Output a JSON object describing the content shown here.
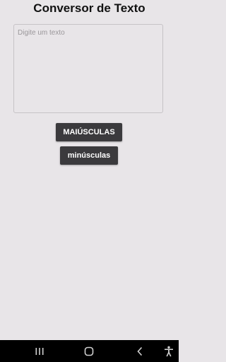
{
  "app": {
    "title": "Conversor de Texto"
  },
  "input": {
    "placeholder": "Digite um texto",
    "value": ""
  },
  "buttons": {
    "uppercase_label": "MAIÚSCULAS",
    "lowercase_label": "minúsculas"
  },
  "navbar": {
    "icons": [
      "recent-apps-icon",
      "home-icon",
      "back-icon",
      "accessibility-icon"
    ]
  },
  "colors": {
    "background": "#e8e5e8",
    "button": "#3b3a3d",
    "navbar": "#000000"
  }
}
